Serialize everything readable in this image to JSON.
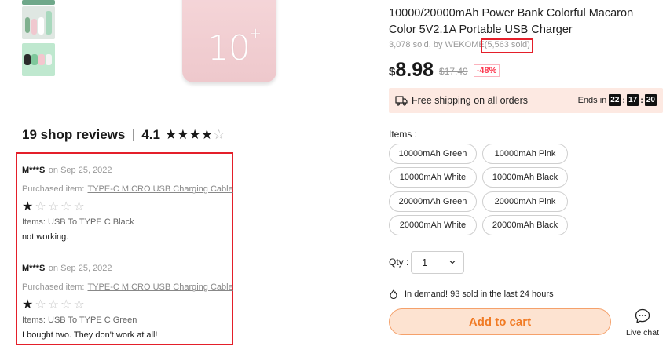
{
  "product": {
    "title": "10000/20000mAh Power Bank Colorful Macaron Color 5V2.1A Portable USB Charger",
    "sold_by": "3,078 sold, by WEKOME",
    "sold_count": "(5,563 sold)",
    "image_capacity": "10",
    "image_plus": "+"
  },
  "price": {
    "currency": "$",
    "current": "8.98",
    "original": "$17.49",
    "discount": "-48%"
  },
  "shipping": {
    "text": "Free shipping on all orders",
    "ends_label": "Ends in",
    "hours": "22",
    "minutes": "17",
    "seconds": "20"
  },
  "items": {
    "label": "Items :",
    "options": [
      "10000mAh Green",
      "10000mAh Pink",
      "10000mAh White",
      "10000mAh Black",
      "20000mAh Green",
      "20000mAh Pink",
      "20000mAh White",
      "20000mAh Black"
    ]
  },
  "quantity": {
    "label": "Qty :",
    "value": "1"
  },
  "demand": "In demand! 93 sold in the last 24 hours",
  "add_to_cart": "Add to cart",
  "live_chat": "Live chat",
  "reviews": {
    "count_text": "19 shop reviews",
    "score": "4.1",
    "score_stars": "★★★★",
    "score_empty": "☆",
    "list": [
      {
        "user": "M***S",
        "date": "on Sep 25, 2022",
        "purchased_label": "Purchased item:",
        "purchased_link": "TYPE-C MICRO USB Charging Cable",
        "rating": 1,
        "filled": "★",
        "empty": "☆☆☆☆",
        "item": "Items: USB To TYPE C Black",
        "text": "not working."
      },
      {
        "user": "M***S",
        "date": "on Sep 25, 2022",
        "purchased_label": "Purchased item:",
        "purchased_link": "TYPE-C MICRO USB Charging Cable",
        "rating": 1,
        "filled": "★",
        "empty": "☆☆☆☆",
        "item": "Items: USB To TYPE C Green",
        "text": "I bought two. They don't work at all!"
      }
    ]
  },
  "colors": {
    "accent_orange": "#f17b25",
    "highlight_red": "#e41f2a",
    "discount_red": "#fd384f",
    "shipping_bg": "#fde9e2"
  }
}
